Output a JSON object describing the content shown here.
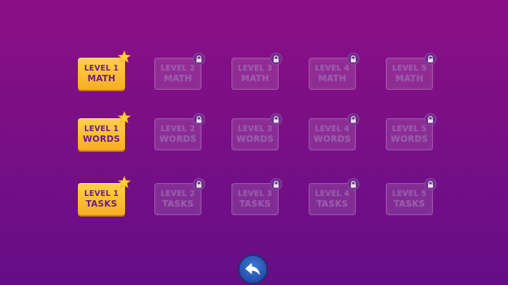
{
  "colors": {
    "background_top": "#8b0f86",
    "background_bottom": "#650e86",
    "unlocked_tile": "#f7ae22",
    "unlocked_text": "#6a1f88",
    "star": "#ffd23a",
    "back_button": "#2b55b0"
  },
  "rows": [
    {
      "category": "math",
      "tiles": [
        {
          "line1": "LEVEL 1",
          "line2": "MATH",
          "state": "unlocked",
          "icon": "star-icon"
        },
        {
          "line1": "LEVEL 2",
          "line2": "MATH",
          "state": "locked",
          "icon": "lock-icon"
        },
        {
          "line1": "LEVEL 3",
          "line2": "MATH",
          "state": "locked",
          "icon": "lock-icon"
        },
        {
          "line1": "LEVEL 4",
          "line2": "MATH",
          "state": "locked",
          "icon": "lock-icon"
        },
        {
          "line1": "LEVEL 5",
          "line2": "MATH",
          "state": "locked",
          "icon": "lock-icon"
        }
      ]
    },
    {
      "category": "words",
      "tiles": [
        {
          "line1": "LEVEL 1",
          "line2": "WORDS",
          "state": "unlocked",
          "icon": "star-icon"
        },
        {
          "line1": "LEVEL 2",
          "line2": "WORDS",
          "state": "locked",
          "icon": "lock-icon"
        },
        {
          "line1": "LEVEL 3",
          "line2": "WORDS",
          "state": "locked",
          "icon": "lock-icon"
        },
        {
          "line1": "LEVEL 4",
          "line2": "WORDS",
          "state": "locked",
          "icon": "lock-icon"
        },
        {
          "line1": "LEVEL 5",
          "line2": "WORDS",
          "state": "locked",
          "icon": "lock-icon"
        }
      ]
    },
    {
      "category": "tasks",
      "tiles": [
        {
          "line1": "LEVEL 1",
          "line2": "TASKS",
          "state": "unlocked",
          "icon": "star-icon"
        },
        {
          "line1": "LEVEL 2",
          "line2": "TASKS",
          "state": "locked",
          "icon": "lock-icon"
        },
        {
          "line1": "LEVEL 3",
          "line2": "TASKS",
          "state": "locked",
          "icon": "lock-icon"
        },
        {
          "line1": "LEVEL 4",
          "line2": "TASKS",
          "state": "locked",
          "icon": "lock-icon"
        },
        {
          "line1": "LEVEL 5",
          "line2": "TASKS",
          "state": "locked",
          "icon": "lock-icon"
        }
      ]
    }
  ],
  "back_button": {
    "icon": "back-arrow-icon"
  }
}
